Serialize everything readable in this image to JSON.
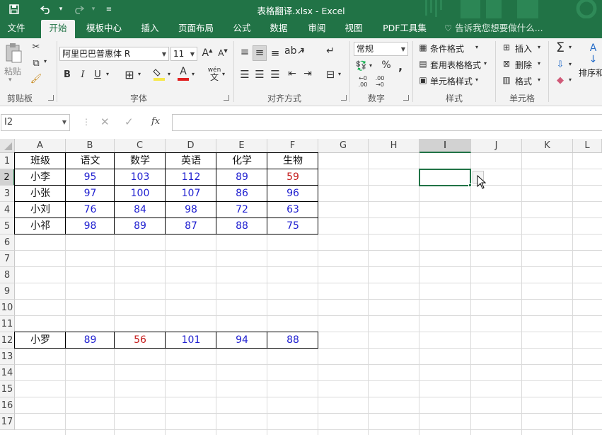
{
  "window": {
    "title": "表格翻译.xlsx - Excel"
  },
  "quick_access": {
    "save_icon": "save-icon",
    "undo_icon": "undo-icon",
    "redo_icon": "redo-icon",
    "customize_icon": "customize-icon"
  },
  "tabs": [
    {
      "label": "文件"
    },
    {
      "label": "开始"
    },
    {
      "label": "模板中心"
    },
    {
      "label": "插入"
    },
    {
      "label": "页面布局"
    },
    {
      "label": "公式"
    },
    {
      "label": "数据"
    },
    {
      "label": "审阅"
    },
    {
      "label": "视图"
    },
    {
      "label": "PDF工具集"
    }
  ],
  "tell_me": "告诉我您想要做什么...",
  "ribbon": {
    "clipboard": {
      "label": "剪贴板",
      "paste": "粘贴"
    },
    "font": {
      "label": "字体",
      "name": "阿里巴巴普惠体 R",
      "size": "11"
    },
    "alignment": {
      "label": "对齐方式"
    },
    "number": {
      "label": "数字",
      "format": "常规"
    },
    "styles": {
      "label": "样式",
      "conditional": "条件格式",
      "table": "套用表格格式",
      "cell": "单元格样式"
    },
    "cells": {
      "label": "单元格",
      "insert": "插入",
      "delete": "删除",
      "format": "格式"
    },
    "editing": {
      "sort": "排序和"
    }
  },
  "formula_bar": {
    "name_box": "I2",
    "formula": ""
  },
  "sheet": {
    "columns": [
      "A",
      "B",
      "C",
      "D",
      "E",
      "F",
      "G",
      "H",
      "I",
      "J",
      "K",
      "L"
    ],
    "rows": [
      "1",
      "2",
      "3",
      "4",
      "5",
      "6",
      "7",
      "8",
      "9",
      "10",
      "11",
      "12",
      "13",
      "14",
      "15",
      "16",
      "17"
    ],
    "selected_column": "I",
    "selected_row": "2",
    "header": [
      "班级",
      "语文",
      "数学",
      "英语",
      "化学",
      "生物"
    ],
    "data": [
      [
        "小李",
        "95",
        "103",
        "112",
        "89",
        "59"
      ],
      [
        "小张",
        "97",
        "100",
        "107",
        "86",
        "96"
      ],
      [
        "小刘",
        "76",
        "84",
        "98",
        "72",
        "63"
      ],
      [
        "小祁",
        "98",
        "89",
        "87",
        "88",
        "75"
      ]
    ],
    "row12": [
      "小罗",
      "89",
      "56",
      "101",
      "94",
      "88"
    ],
    "red_cells": [
      "2F",
      "12C"
    ]
  },
  "colors": {
    "excel_green": "#217346",
    "value_blue": "#1f1fd0",
    "value_red": "#c41a1a"
  }
}
